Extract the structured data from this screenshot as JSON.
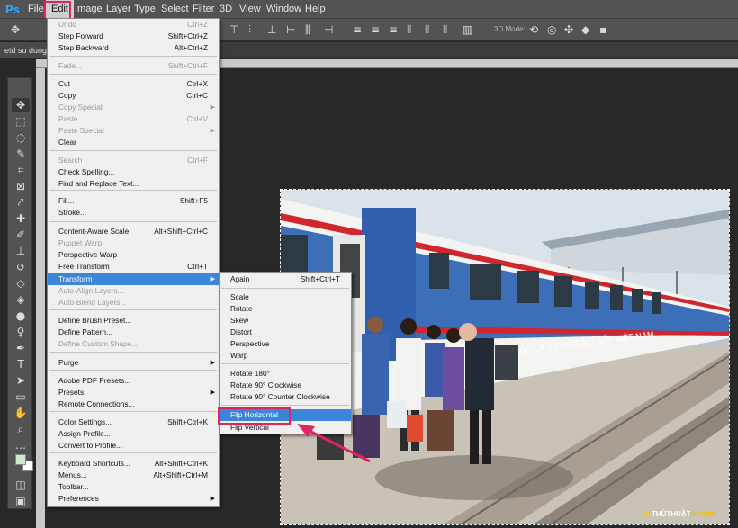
{
  "app": {
    "logo": "Ps"
  },
  "menubar": {
    "items": [
      "File",
      "Edit",
      "Image",
      "Layer",
      "Type",
      "Select",
      "Filter",
      "3D",
      "View",
      "Window",
      "Help"
    ]
  },
  "options": {
    "mode_label": "3D Mode:"
  },
  "document": {
    "tab_label": "etd su dung"
  },
  "edit_menu": {
    "items": [
      {
        "label": "Undo",
        "shortcut": "Ctrl+Z",
        "disabled": true
      },
      {
        "label": "Step Forward",
        "shortcut": "Shift+Ctrl+Z",
        "disabled": false
      },
      {
        "label": "Step Backward",
        "shortcut": "Alt+Ctrl+Z",
        "disabled": false
      },
      {
        "label": "Fade...",
        "shortcut": "Shift+Ctrl+F",
        "disabled": true
      },
      {
        "label": "Cut",
        "shortcut": "Ctrl+X",
        "disabled": false
      },
      {
        "label": "Copy",
        "shortcut": "Ctrl+C",
        "disabled": false
      },
      {
        "label": "Copy Special",
        "shortcut": "",
        "disabled": true,
        "submenu": true
      },
      {
        "label": "Paste",
        "shortcut": "Ctrl+V",
        "disabled": true
      },
      {
        "label": "Paste Special",
        "shortcut": "",
        "disabled": true,
        "submenu": true
      },
      {
        "label": "Clear",
        "shortcut": "",
        "disabled": false
      },
      {
        "label": "Search",
        "shortcut": "Ctrl+F",
        "disabled": true
      },
      {
        "label": "Check Spelling...",
        "shortcut": "",
        "disabled": false
      },
      {
        "label": "Find and Replace Text...",
        "shortcut": "",
        "disabled": false
      },
      {
        "label": "Fill...",
        "shortcut": "Shift+F5",
        "disabled": false
      },
      {
        "label": "Stroke...",
        "shortcut": "",
        "disabled": false
      },
      {
        "label": "Content-Aware Scale",
        "shortcut": "Alt+Shift+Ctrl+C",
        "disabled": false
      },
      {
        "label": "Puppet Warp",
        "shortcut": "",
        "disabled": true
      },
      {
        "label": "Perspective Warp",
        "shortcut": "",
        "disabled": false
      },
      {
        "label": "Free Transform",
        "shortcut": "Ctrl+T",
        "disabled": false
      },
      {
        "label": "Transform",
        "shortcut": "",
        "disabled": false,
        "submenu": true,
        "highlighted": true
      },
      {
        "label": "Auto-Align Layers...",
        "shortcut": "",
        "disabled": true
      },
      {
        "label": "Auto-Blend Layers...",
        "shortcut": "",
        "disabled": true
      },
      {
        "label": "Define Brush Preset...",
        "shortcut": "",
        "disabled": false
      },
      {
        "label": "Define Pattern...",
        "shortcut": "",
        "disabled": false
      },
      {
        "label": "Define Custom Shape...",
        "shortcut": "",
        "disabled": true
      },
      {
        "label": "Purge",
        "shortcut": "",
        "disabled": false,
        "submenu": true
      },
      {
        "label": "Adobe PDF Presets...",
        "shortcut": "",
        "disabled": false
      },
      {
        "label": "Presets",
        "shortcut": "",
        "disabled": false,
        "submenu": true
      },
      {
        "label": "Remote Connections...",
        "shortcut": "",
        "disabled": false
      },
      {
        "label": "Color Settings...",
        "shortcut": "Shift+Ctrl+K",
        "disabled": false
      },
      {
        "label": "Assign Profile...",
        "shortcut": "",
        "disabled": false
      },
      {
        "label": "Convert to Profile...",
        "shortcut": "",
        "disabled": false
      },
      {
        "label": "Keyboard Shortcuts...",
        "shortcut": "Alt+Shift+Ctrl+K",
        "disabled": false
      },
      {
        "label": "Menus...",
        "shortcut": "Alt+Shift+Ctrl+M",
        "disabled": false
      },
      {
        "label": "Toolbar...",
        "shortcut": "",
        "disabled": false
      },
      {
        "label": "Preferences",
        "shortcut": "",
        "disabled": false,
        "submenu": true
      }
    ]
  },
  "transform_menu": {
    "items": [
      {
        "label": "Again",
        "shortcut": "Shift+Ctrl+T"
      },
      {
        "label": "Scale",
        "shortcut": ""
      },
      {
        "label": "Rotate",
        "shortcut": ""
      },
      {
        "label": "Skew",
        "shortcut": ""
      },
      {
        "label": "Distort",
        "shortcut": ""
      },
      {
        "label": "Perspective",
        "shortcut": ""
      },
      {
        "label": "Warp",
        "shortcut": ""
      },
      {
        "label": "Rotate 180°",
        "shortcut": ""
      },
      {
        "label": "Rotate 90° Clockwise",
        "shortcut": ""
      },
      {
        "label": "Rotate 90° Counter Clockwise",
        "shortcut": ""
      },
      {
        "label": "Flip Horizontal",
        "shortcut": "",
        "highlighted": true
      },
      {
        "label": "Flip Vertical",
        "shortcut": ""
      }
    ]
  },
  "photo": {
    "train_text": "MỘC LÀ XỨ ĐƯỜNG SẮT VIỆT NAM"
  },
  "watermark": {
    "part_a": "⚡THỦTHUẬT",
    "part_b": "NHANH"
  },
  "colors": {
    "accent_red": "#e0245e",
    "menu_highlight": "#3b86d8",
    "ps_blue": "#31a8ff"
  }
}
